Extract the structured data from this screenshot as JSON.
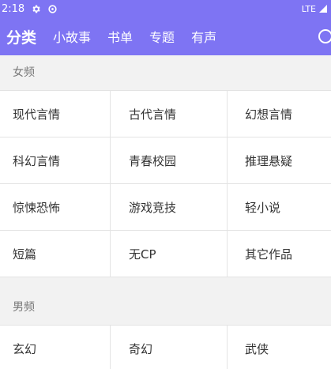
{
  "status": {
    "time": "2:18",
    "network": "LTE"
  },
  "nav": {
    "tabs": [
      {
        "label": "分类"
      },
      {
        "label": "小故事"
      },
      {
        "label": "书单"
      },
      {
        "label": "专题"
      },
      {
        "label": "有声"
      }
    ]
  },
  "sections": [
    {
      "title": "女频",
      "items": [
        "现代言情",
        "古代言情",
        "幻想言情",
        "科幻言情",
        "青春校园",
        "推理悬疑",
        "惊悚恐怖",
        "游戏竞技",
        "轻小说",
        "短篇",
        "无CP",
        "其它作品"
      ]
    },
    {
      "title": "男频",
      "items": [
        "玄幻",
        "奇幻",
        "武侠"
      ]
    }
  ],
  "colors": {
    "accent": "#7e74f3"
  }
}
